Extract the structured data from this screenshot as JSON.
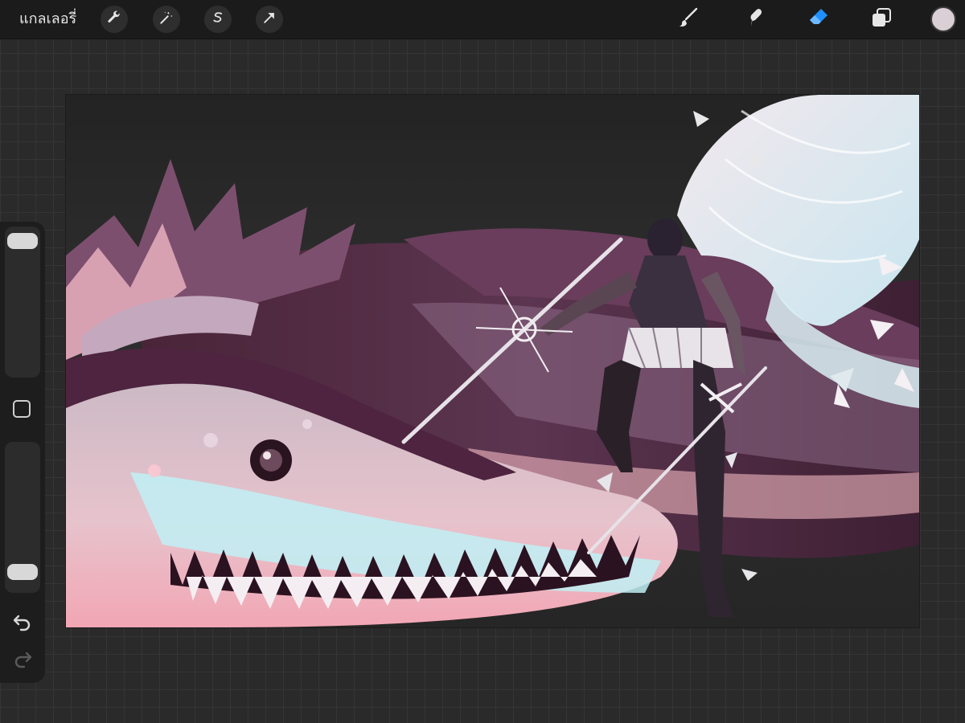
{
  "topbar": {
    "gallery_label": "แกลเลอรี่",
    "actions": [
      {
        "name": "wrench-icon"
      },
      {
        "name": "magic-wand-icon"
      },
      {
        "name": "selection-icon"
      },
      {
        "name": "transform-arrow-icon"
      }
    ],
    "tools": [
      {
        "name": "brush-icon",
        "active": false
      },
      {
        "name": "smudge-icon",
        "active": false
      },
      {
        "name": "eraser-icon",
        "active": true
      },
      {
        "name": "layers-icon",
        "active": false
      }
    ],
    "current_color": "#d9cfd4"
  },
  "sidebar": {
    "brush_size_level": 0.05,
    "opacity_level": 0.95,
    "undo_icon": "undo-arrow-icon",
    "redo_icon": "redo-arrow-icon"
  },
  "colors": {
    "accent": "#1e90ff",
    "background": "#2a2a2a",
    "toolbar": "#1b1b1b"
  }
}
